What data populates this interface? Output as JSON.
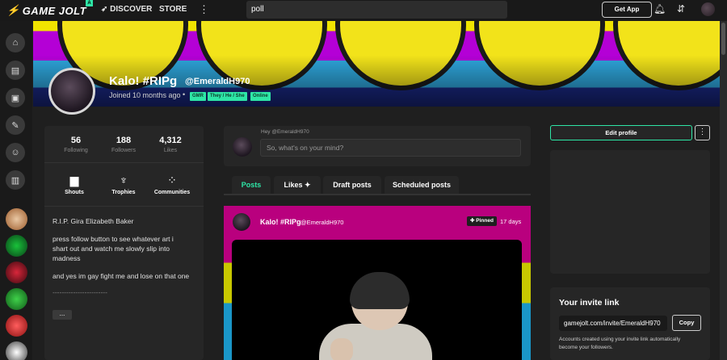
{
  "topbar": {
    "logo_text": "GAME JOLT",
    "logo_badge": "A",
    "discover_label": "DISCOVER",
    "store_label": "STORE",
    "search_value": "poll",
    "get_app_label": "Get App"
  },
  "profile": {
    "name": "Kalo! #RIPg",
    "handle": "@EmeraldH970",
    "joined": "Joined 10 months ago",
    "tags": [
      "GMR",
      "They / He / She",
      "Online"
    ],
    "stats": [
      {
        "value": "56",
        "label": "Following"
      },
      {
        "value": "188",
        "label": "Followers"
      },
      {
        "value": "4,312",
        "label": "Likes"
      }
    ],
    "shortcuts": [
      "Shouts",
      "Trophies",
      "Communities"
    ],
    "bio": [
      "R.I.P. Gira Elizabeth Baker",
      "press follow button to see whatever art i shart out and watch me slowly slip into madness",
      "and yes im gay fight me and lose on that one",
      "------------------------"
    ],
    "more_label": "..."
  },
  "composer": {
    "hey_label": "Hey @EmeraldH970",
    "placeholder": "So, what's on your mind?"
  },
  "tabs": [
    "Posts",
    "Likes",
    "Draft posts",
    "Scheduled posts"
  ],
  "post": {
    "author": "Kalo! #RIPg",
    "handle": "@EmeraldH970",
    "pinned_label": "Pinned",
    "time": "17 days"
  },
  "sidebar_right": {
    "edit_profile_label": "Edit profile",
    "invite_title": "Your invite link",
    "invite_url": "gamejolt.com/invite/EmeraldH970",
    "copy_label": "Copy",
    "invite_note": "Accounts created using your invite link automatically become your followers."
  },
  "colors": {
    "accent": "#2ee6a6",
    "background": "#1f1f1f",
    "card": "#262626"
  }
}
